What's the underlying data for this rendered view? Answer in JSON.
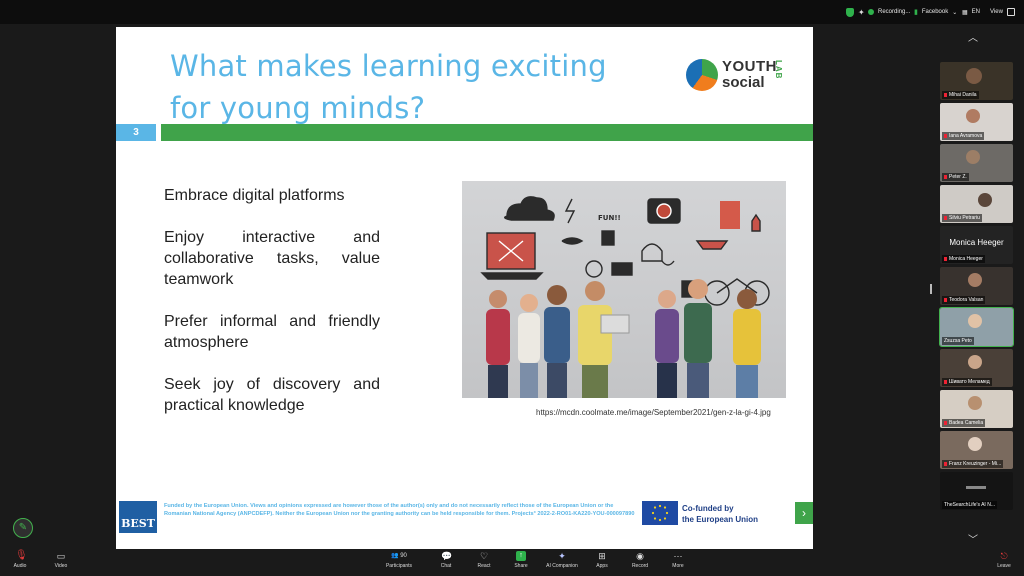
{
  "topbar": {
    "recording_label": "Recording...",
    "facebook_label": "Facebook",
    "lang_label": "EN",
    "view_label": "View"
  },
  "slide": {
    "title_line1": "What makes learning exciting",
    "title_line2": "for young minds?",
    "slide_number": "3",
    "logo_line1": "YOUTH",
    "logo_line2": "social",
    "logo_line3": "LAB",
    "bullets": [
      "Embrace digital platforms",
      "Enjoy interactive and collaborative tasks, value teamwork",
      "Prefer informal and friendly atmosphere",
      "Seek joy of discovery and practical knowledge"
    ],
    "image_url": "https://mcdn.coolmate.me/image/September2021/gen-z-la-gi-4.jpg",
    "footer_logo": "BEST",
    "footer_text": "Funded by the European Union. Views and opinions expressed are however those of the author(s) only and do not necessarily reflect those of the European Union or the Romanian National Agency (ANPCDEFP). Neither the European Union nor the granting authority can be held responsible for them. Projects° 2022-2-RO01-KA220-YOU-000097890",
    "eu_line1": "Co-funded by",
    "eu_line2": "the European Union"
  },
  "participants": [
    {
      "name": "Mihai Danila"
    },
    {
      "name": "Iana Avramova"
    },
    {
      "name": "Peter Z."
    },
    {
      "name": "Silviu Petrariu"
    },
    {
      "name": "Monica Heeger",
      "big": "Monica Heeger"
    },
    {
      "name": "Teodora Valsan"
    },
    {
      "name": "Zsuzsa Peto"
    },
    {
      "name": "Шивато Меламед"
    },
    {
      "name": "Badea Camelia"
    },
    {
      "name": "Franz Kreuzinger - Mi..."
    },
    {
      "name": "TheSearchLife's AI N..."
    }
  ],
  "toolbar": {
    "audio": "Audio",
    "video": "Video",
    "participants": "Participants",
    "participants_count": "90",
    "chat": "Chat",
    "react": "React",
    "share": "Share",
    "ai_companion": "AI Companion",
    "apps": "Apps",
    "record": "Record",
    "more": "More",
    "leave": "Leave"
  },
  "colors": {
    "title_blue": "#5ab6e6",
    "bar_green": "#40a34a",
    "share_green": "#2fb24c",
    "leave_red": "#e23a3a"
  }
}
